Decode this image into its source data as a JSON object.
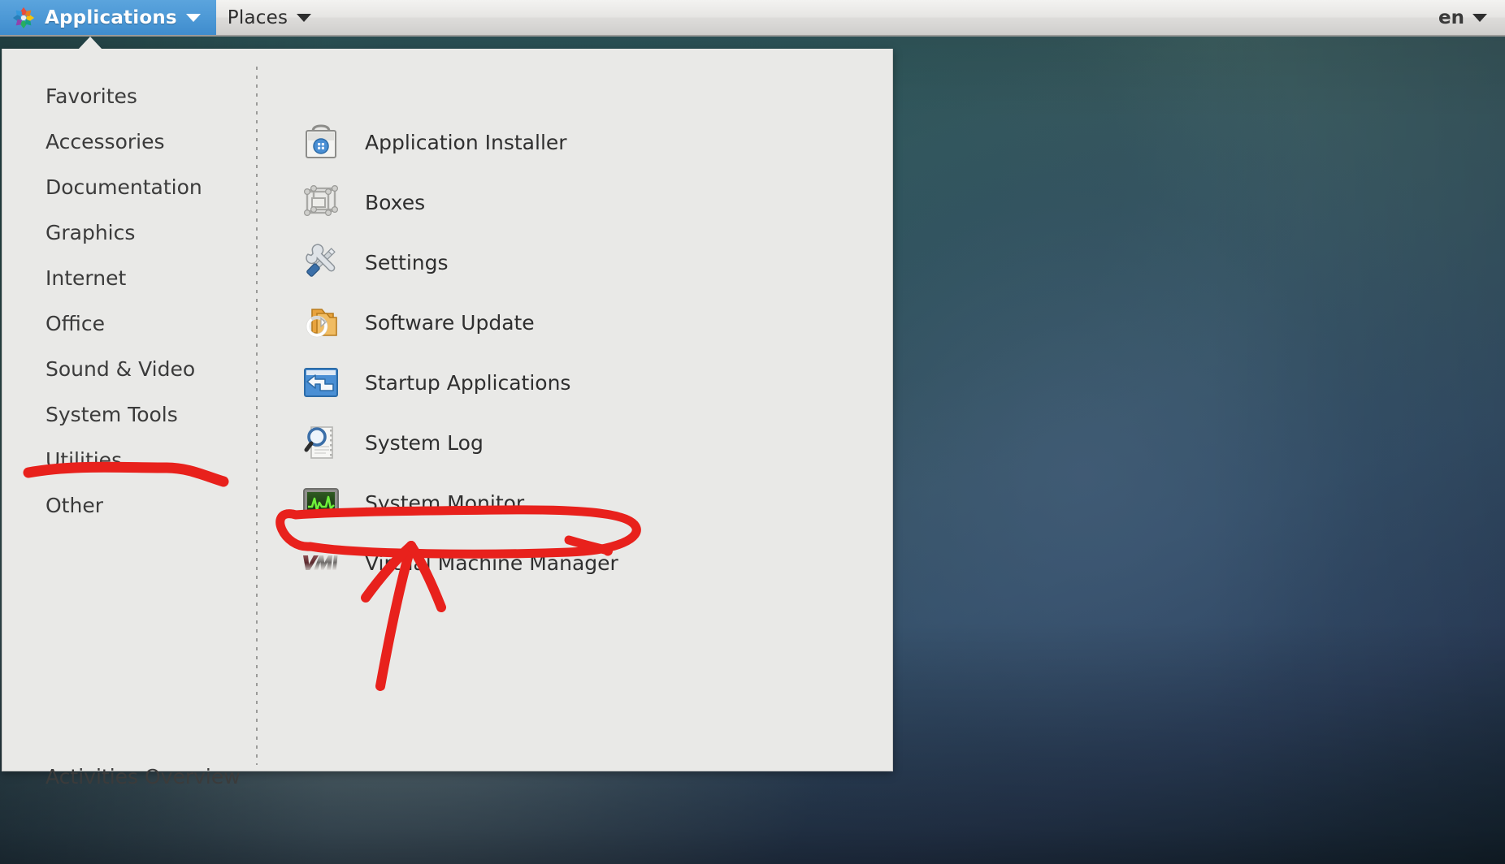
{
  "panel": {
    "applications_label": "Applications",
    "places_label": "Places",
    "language_label": "en",
    "logo_icon": "fedora-pinwheel-icon",
    "caret_icon": "chevron-down-icon",
    "active_button": "Applications"
  },
  "menu": {
    "categories": [
      {
        "label": "Favorites",
        "name": "favorites"
      },
      {
        "label": "Accessories",
        "name": "accessories"
      },
      {
        "label": "Documentation",
        "name": "documentation"
      },
      {
        "label": "Graphics",
        "name": "graphics"
      },
      {
        "label": "Internet",
        "name": "internet"
      },
      {
        "label": "Office",
        "name": "office"
      },
      {
        "label": "Sound & Video",
        "name": "sound-video"
      },
      {
        "label": "System Tools",
        "name": "system-tools"
      },
      {
        "label": "Utilities",
        "name": "utilities"
      },
      {
        "label": "Other",
        "name": "other"
      }
    ],
    "activities_overview_label": "Activities Overview",
    "applications": [
      {
        "label": "Application Installer",
        "icon": "package-bag-icon"
      },
      {
        "label": "Boxes",
        "icon": "wireframe-box-icon"
      },
      {
        "label": "Settings",
        "icon": "wrench-screwdriver-icon"
      },
      {
        "label": "Software Update",
        "icon": "software-update-icon"
      },
      {
        "label": "Startup Applications",
        "icon": "startup-window-icon"
      },
      {
        "label": "System Log",
        "icon": "magnifier-document-icon"
      },
      {
        "label": "System Monitor",
        "icon": "monitor-graph-icon"
      },
      {
        "label": "Virtual Machine Manager",
        "icon": "vmm-logo-icon"
      }
    ]
  },
  "annotations": {
    "color": "#E8211C",
    "underline_target": "System Tools",
    "ellipse_target": "Virtual Machine Manager",
    "arrow_target": "Virtual Machine Manager"
  },
  "colors": {
    "panel_active": "#4d99d6",
    "menu_background": "#e9e9e7",
    "annotation_red": "#E8211C",
    "wallpaper_teal": "#3a5a60",
    "wallpaper_navy": "#1d3344"
  }
}
